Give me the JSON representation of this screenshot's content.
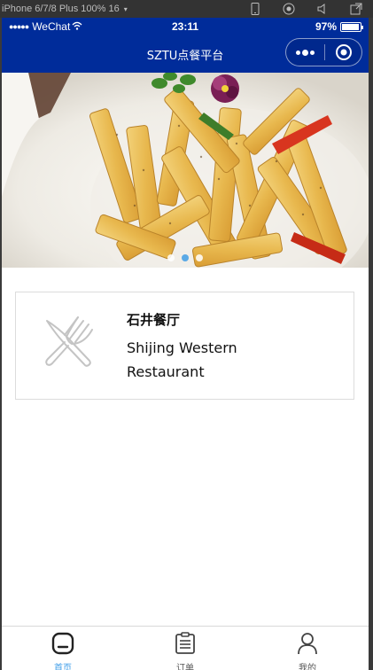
{
  "simulator": {
    "device_label": "iPhone 6/7/8 Plus 100% 16",
    "caret": "▾",
    "icons": [
      "phone-icon",
      "record-icon",
      "volume-icon",
      "external-window-icon"
    ]
  },
  "status_bar": {
    "signal": "●●●●●",
    "carrier": "WeChat",
    "time": "23:11",
    "battery": "97%",
    "battery_level": 0.97
  },
  "nav": {
    "title": "SZTU点餐平台",
    "more_icon": "more-dots-icon",
    "close_icon": "target-circle-icon"
  },
  "banner": {
    "indicator_count": 3,
    "active_index": 1
  },
  "restaurant": {
    "name": "石井餐厅",
    "description": "Shijing Western Restaurant",
    "icon": "fork-knife-icon"
  },
  "tabbar": {
    "items": [
      {
        "label": "首页",
        "icon": "home-icon",
        "active": true
      },
      {
        "label": "订单",
        "icon": "order-icon",
        "active": false
      },
      {
        "label": "我的",
        "icon": "user-icon",
        "active": false
      }
    ]
  },
  "colors": {
    "nav_bg": "#002c9a",
    "active_tab": "#3a9be8",
    "card_border": "#dcdcdc"
  }
}
